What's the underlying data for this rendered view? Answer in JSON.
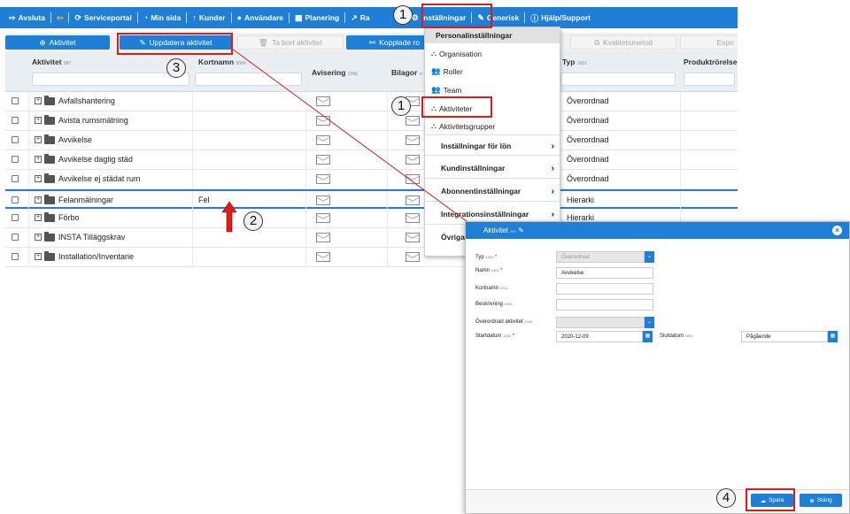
{
  "nav": {
    "items": [
      {
        "icon": "exit-icon",
        "glyph": "⇨",
        "label": "Avsluta"
      },
      {
        "icon": "back-icon",
        "glyph": "⇦",
        "label": ""
      },
      {
        "icon": "sync-icon",
        "glyph": "⟳",
        "label": "Serviceportal"
      },
      {
        "icon": "dashboard-icon",
        "glyph": "◔",
        "label": "Min sida"
      },
      {
        "icon": "up-arrow-icon",
        "glyph": "↑",
        "label": "Kunder"
      },
      {
        "icon": "user-icon",
        "glyph": "●",
        "label": "Användare"
      },
      {
        "icon": "calendar-icon",
        "glyph": "▦",
        "label": "Planering"
      },
      {
        "icon": "chart-icon",
        "glyph": "↗",
        "label": "Ra"
      },
      {
        "icon": "gears-icon",
        "glyph": "⚙",
        "label": "Inställningar"
      },
      {
        "icon": "wrench-icon",
        "glyph": "✎",
        "label": "Generisk"
      },
      {
        "icon": "info-icon",
        "glyph": "ⓘ",
        "label": "Hjälp/Support"
      }
    ]
  },
  "toolbar": {
    "add_label": "Aktivitet",
    "update_label": "Uppdatera aktivitet",
    "delete_label": "Ta bort aktivitet",
    "linked_label": "Kopplade ro",
    "quality_label": "Kvalitetsmetod",
    "export_label": "Expo"
  },
  "table": {
    "headers": {
      "activity": "Aktivitet",
      "activity_id": "997",
      "shortname": "Kortnamn",
      "shortname_id": "5666",
      "notice": "Avisering",
      "notice_id": "2266",
      "attachments": "Bilagor",
      "attachments_id": "rc",
      "type": "Typ",
      "type_id": "1001",
      "product": "Produktrörelse"
    },
    "rows": [
      {
        "name": "Avfallshantering",
        "short": "",
        "type": "Överordnad"
      },
      {
        "name": "Avista rumsmätning",
        "short": "",
        "type": "Överordnad"
      },
      {
        "name": "Avvikelse",
        "short": "",
        "type": "Överordnad"
      },
      {
        "name": "Avvikelse daglig städ",
        "short": "",
        "type": "Överordnad"
      },
      {
        "name": "Avvikelse ej städat rum",
        "short": "",
        "type": "Överordnad"
      },
      {
        "name": "Felanmälningar",
        "short": "Fel",
        "type": "Hierarki"
      },
      {
        "name": "Förbo",
        "short": "",
        "type": "Hierarki"
      },
      {
        "name": "INSTA Tilläggskrav",
        "short": "",
        "type": ""
      },
      {
        "name": "Installation/Inventarie",
        "short": "",
        "type": ""
      }
    ]
  },
  "menu": {
    "header": "Personalinställningar",
    "items": [
      {
        "icon": "org-icon",
        "label": "Organisation"
      },
      {
        "icon": "users-icon",
        "label": "Roller"
      },
      {
        "icon": "team-icon",
        "label": "Team"
      },
      {
        "icon": "sitemap-icon",
        "label": "Aktiviteter"
      },
      {
        "icon": "sitemap-icon",
        "label": "Aktivitetsgrupper"
      }
    ],
    "sections": [
      {
        "label": "Inställningar för lön"
      },
      {
        "label": "Kundinställningar"
      },
      {
        "label": "Abonnentinställningar"
      },
      {
        "label": "Integrationsinställningar"
      },
      {
        "label": "Övriga"
      }
    ]
  },
  "annotations": {
    "n1": "1",
    "n2": "2",
    "n3": "3",
    "n4": "4"
  },
  "dialog": {
    "title": "Aktivitet",
    "title_id": "997",
    "fields": {
      "type_label": "Typ",
      "type_id": "1004",
      "type_value": "Överordnad",
      "name_label": "Namn",
      "name_id": "1002",
      "name_value": "Avvikelse",
      "short_label": "Kortnamn",
      "short_id": "1211",
      "short_value": "",
      "desc_label": "Beskrivning",
      "desc_id": "1003",
      "desc_value": "",
      "parent_label": "Överordnad aktivitet",
      "parent_id": "1004",
      "parent_value": "",
      "start_label": "Startdatum",
      "start_id": "1000",
      "start_value": "2020-12-09",
      "end_label": "Slutdatum",
      "end_id": "1001",
      "end_value": "Pågående"
    },
    "save_label": "Spara",
    "close_label": "Stäng"
  },
  "colors": {
    "accent": "#1f7fd6",
    "highlight": "#e01b1b"
  }
}
